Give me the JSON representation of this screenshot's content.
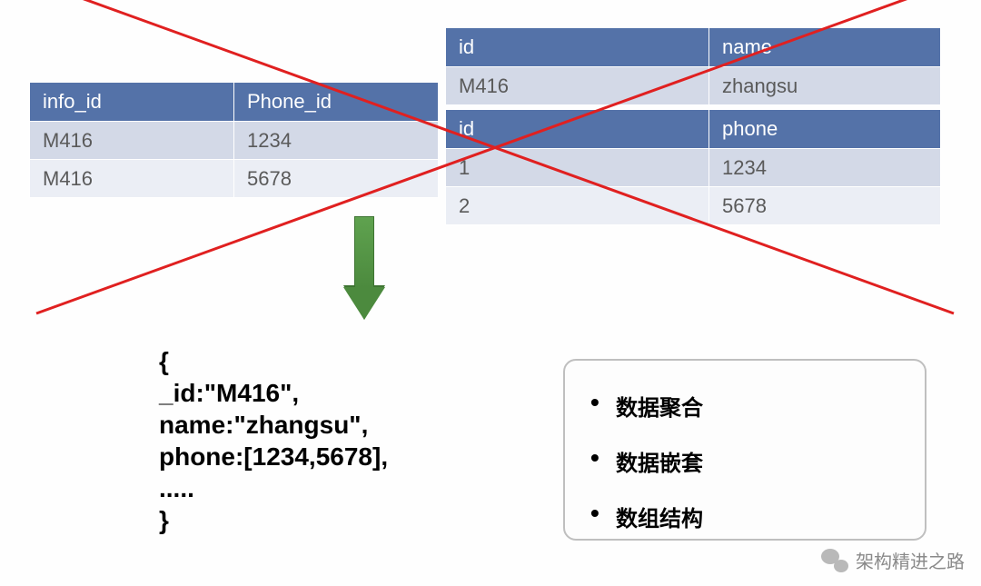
{
  "table1": {
    "headers": [
      "info_id",
      "Phone_id"
    ],
    "rows": [
      [
        "M416",
        "1234"
      ],
      [
        "M416",
        "5678"
      ]
    ]
  },
  "table2": {
    "headers": [
      "id",
      "name"
    ],
    "rows": [
      [
        "M416",
        "zhangsu"
      ]
    ]
  },
  "table3": {
    "headers": [
      "id",
      "phone"
    ],
    "rows": [
      [
        "1",
        "1234"
      ],
      [
        "2",
        "5678"
      ]
    ]
  },
  "code": {
    "line1": "{",
    "line2": "_id:\"M416\",",
    "line3": "name:\"zhangsu\",",
    "line4": "phone:[1234,5678],",
    "line5": ".....",
    "line6": "}"
  },
  "callout": {
    "item1": "数据聚合",
    "item2": "数据嵌套",
    "item3": "数组结构"
  },
  "watermark": "架构精进之路"
}
